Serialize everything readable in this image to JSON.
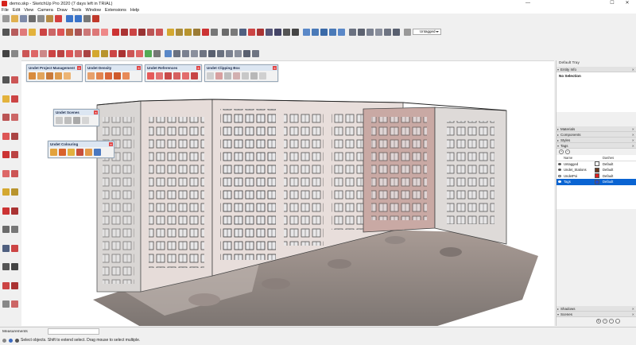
{
  "window": {
    "title": "demo.skp - SketchUp Pro 2020 (7 days left in TRIAL)",
    "minimize": "—",
    "maximize": "☐",
    "close": "✕"
  },
  "menu": [
    "File",
    "Edit",
    "View",
    "Camera",
    "Draw",
    "Tools",
    "Window",
    "Extensions",
    "Help"
  ],
  "toolbar": {
    "tag_dropdown": "Untagged"
  },
  "floating_toolbars": {
    "project_management": "Undet Project Management",
    "density": "Undet Density",
    "references": "Undet References",
    "clipping_box": "Undet Clipping Box",
    "scenes": "Undet Scenes",
    "colouring": "Undet Colouring"
  },
  "tray": {
    "title": "Default Tray",
    "entity_info": "Entity Info",
    "entity_value": "No Selection",
    "materials": "Materials",
    "components": "Components",
    "styles": "Styles",
    "tags": "Tags",
    "tags_header": {
      "name": "Name",
      "dashes": "Dashes"
    },
    "tag_rows": [
      {
        "name": "Untagged",
        "dashes": "Default",
        "color": "#ffffff"
      },
      {
        "name": "Undet_Stations",
        "dashes": "Default",
        "color": "#6b3a1f"
      },
      {
        "name": "UndetPoi",
        "dashes": "Default",
        "color": "#e01e1e"
      },
      {
        "name": "Tags",
        "dashes": "Default",
        "color": "#1d4fd6"
      }
    ],
    "shadows": "Shadows",
    "scenes": "Scenes"
  },
  "status": {
    "measurements_label": "Measurements",
    "message": "Select objects. Shift to extend select. Drag mouse to select multiple."
  }
}
